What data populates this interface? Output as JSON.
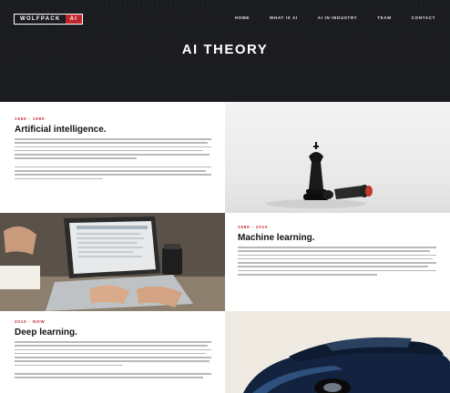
{
  "brand": {
    "name": "WOLFPACK",
    "tag": "AI"
  },
  "nav": [
    {
      "label": "HOME"
    },
    {
      "label": "WHAT IS AI"
    },
    {
      "label": "AI IN INDUSTRY"
    },
    {
      "label": "TEAM"
    },
    {
      "label": "CONTACT"
    }
  ],
  "hero": {
    "title": "AI THEORY"
  },
  "sections": [
    {
      "years": "1950 - 1980",
      "title": "Artificial intelligence."
    },
    {
      "years": "1980 - 2010",
      "title": "Machine learning."
    },
    {
      "years": "2010 - NOW",
      "title": "Deep learning."
    }
  ],
  "colors": {
    "accent": "#c0272d",
    "hero_bg": "#1b1c20"
  }
}
